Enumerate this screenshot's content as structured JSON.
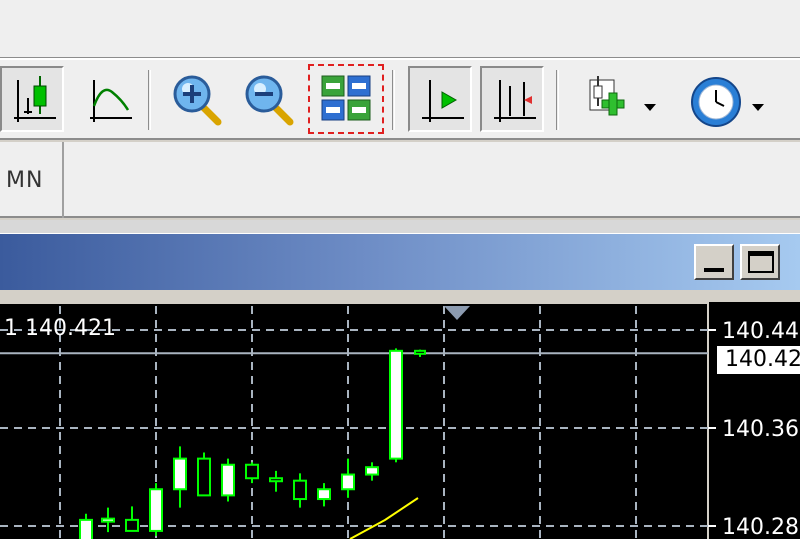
{
  "toolbar": {
    "buttons": [
      {
        "id": "candles",
        "pressed": true
      },
      {
        "id": "line-chart",
        "pressed": false
      },
      {
        "id": "zoom-in",
        "pressed": false
      },
      {
        "id": "zoom-out",
        "pressed": false
      },
      {
        "id": "tile-windows",
        "pressed": false,
        "highlighted": true
      },
      {
        "id": "chart-shift",
        "pressed": true
      },
      {
        "id": "auto-scroll",
        "pressed": true
      },
      {
        "id": "indicators",
        "pressed": false,
        "dropdown": true
      },
      {
        "id": "periods",
        "pressed": false,
        "dropdown": true
      }
    ]
  },
  "periods": {
    "mn_label": "MN"
  },
  "chart": {
    "info_text": "1 140.421",
    "bid_price": "140.42",
    "price_ticks": [
      "140.44",
      "140.36",
      "140.28"
    ],
    "colors": {
      "background": "#000000",
      "grid": "#a9b4c0",
      "candle": "#00ff00",
      "bull_body": "#ffffff",
      "bear_body": "#000000",
      "ma_line": "#ffff00",
      "bid_line": "#a9b4c0"
    }
  },
  "chart_data": {
    "type": "candlestick",
    "y_ticks": [
      140.44,
      140.36,
      140.28
    ],
    "ylim": [
      140.26,
      140.45
    ],
    "bid": 140.421,
    "candles": [
      {
        "o": 140.262,
        "h": 140.29,
        "l": 140.25,
        "c": 140.285
      },
      {
        "o": 140.284,
        "h": 140.295,
        "l": 140.275,
        "c": 140.286
      },
      {
        "o": 140.285,
        "h": 140.296,
        "l": 140.28,
        "c": 140.276
      },
      {
        "o": 140.276,
        "h": 140.315,
        "l": 140.272,
        "c": 140.31
      },
      {
        "o": 140.31,
        "h": 140.345,
        "l": 140.295,
        "c": 140.335
      },
      {
        "o": 140.335,
        "h": 140.34,
        "l": 140.31,
        "c": 140.305
      },
      {
        "o": 140.305,
        "h": 140.335,
        "l": 140.3,
        "c": 140.33
      },
      {
        "o": 140.33,
        "h": 140.332,
        "l": 140.315,
        "c": 140.319
      },
      {
        "o": 140.319,
        "h": 140.325,
        "l": 140.308,
        "c": 140.317
      },
      {
        "o": 140.317,
        "h": 140.323,
        "l": 140.295,
        "c": 140.302
      },
      {
        "o": 140.302,
        "h": 140.315,
        "l": 140.296,
        "c": 140.31
      },
      {
        "o": 140.31,
        "h": 140.335,
        "l": 140.303,
        "c": 140.322
      },
      {
        "o": 140.322,
        "h": 140.332,
        "l": 140.317,
        "c": 140.328
      },
      {
        "o": 140.335,
        "h": 140.425,
        "l": 140.332,
        "c": 140.423
      },
      {
        "o": 140.423,
        "h": 140.424,
        "l": 140.418,
        "c": 140.421
      }
    ],
    "ma": [
      140.262,
      140.274,
      140.285
    ]
  }
}
